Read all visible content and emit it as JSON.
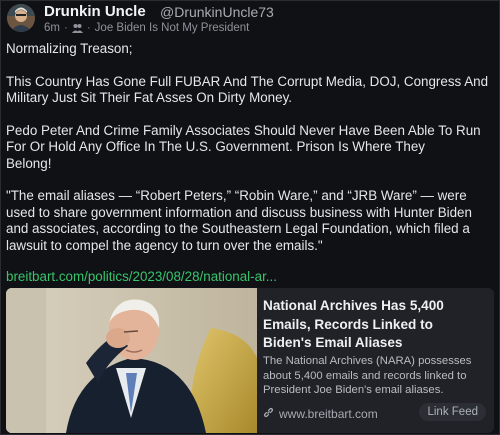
{
  "author": {
    "display_name": "Drunkin Uncle",
    "handle": "@DrunkinUncle73",
    "avatar_icon": "avatar-photo"
  },
  "meta": {
    "time": "6m",
    "separator": "·",
    "group_icon": "group-icon",
    "group_name": "Joe Biden Is Not My President"
  },
  "post": {
    "paragraphs": [
      "Normalizing Treason;",
      "This Country Has Gone Full FUBAR And The Corrupt Media, DOJ, Congress And Military Just Sit Their Fat Asses On Dirty Money.",
      "Pedo Peter And Crime Family Associates Should Never Have Been Able To Run For Or Hold Any Office In The U.S. Government. Prison Is Where They\nBelong!",
      "\"The email aliases — “Robert Peters,” “Robin Ware,” and “JRB Ware” — were used to share government information and discuss business with Hunter Biden and associates, according to the Southeastern Legal Foundation, which filed a lawsuit to compel the agency to turn over the emails.\""
    ],
    "link_text": "breitbart.com/politics/2023/08/28/national-ar..."
  },
  "card": {
    "title": "National Archives Has 5,400 Emails, Records Linked to Biden's Email Aliases",
    "description": "The National Archives (NARA) possesses about 5,400 emails and records linked to President Joe Biden's email aliases.",
    "domain": "www.breitbart.com",
    "link_icon": "link-icon",
    "button_label": "Link Feed"
  },
  "colors": {
    "background": "#101114",
    "link_green": "#38c46d",
    "card_background": "#202227"
  }
}
